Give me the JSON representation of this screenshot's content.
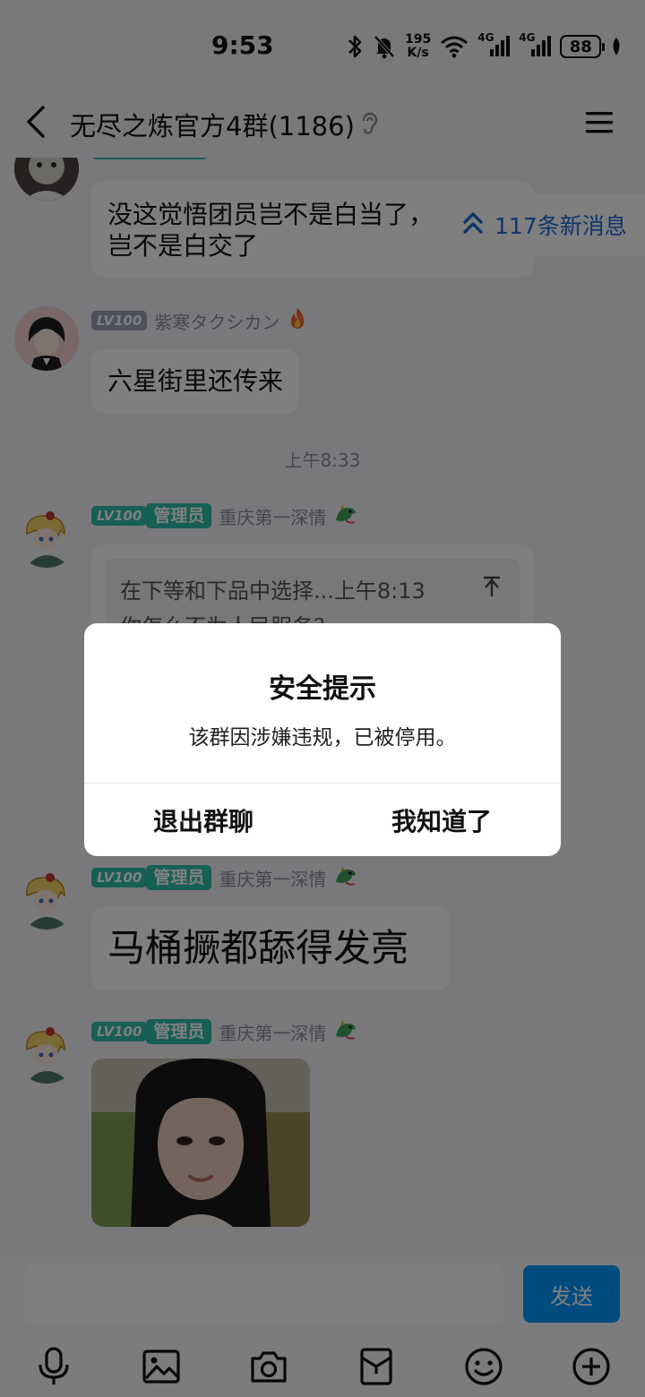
{
  "status_bar": {
    "time": "9:53",
    "net_speed_value": "195",
    "net_speed_unit": "K/s",
    "network_1": "4G",
    "network_2": "4G",
    "battery": "88"
  },
  "nav": {
    "title": "无尽之炼官方4群(1186)"
  },
  "new_messages": {
    "label": "117条新消息"
  },
  "messages": [
    {
      "text_line1": "没这觉悟团员岂不是白当了，",
      "text_line2": "岂不是白交了"
    },
    {
      "level": "LV100",
      "sender": "紫寒タクシカン",
      "text": "六星街里还传来"
    },
    {
      "time": "上午8:33"
    },
    {
      "level": "LV100",
      "role": "管理员",
      "sender": "重庆第一深情",
      "quote": "在下等和下品中选择...上午8:13",
      "quote_line2": "你怎么不为人民服务？"
    },
    {
      "level": "LV100",
      "role": "管理员",
      "sender": "重庆第一深情",
      "text": "马桶撅都舔得发亮"
    },
    {
      "level": "LV100",
      "role": "管理员",
      "sender": "重庆第一深情",
      "image": "photo"
    }
  ],
  "input": {
    "placeholder": "",
    "send_label": "发送"
  },
  "toolbar": {
    "icons": [
      "microphone-icon",
      "image-icon",
      "camera-icon",
      "red-packet-icon",
      "emoji-icon",
      "plus-icon"
    ]
  },
  "dialog": {
    "title": "安全提示",
    "message": "该群因涉嫌违规，已被停用。",
    "left_button": "退出群聊",
    "right_button": "我知道了"
  },
  "colors": {
    "accent": "#0099ff",
    "link": "#1e6bd6",
    "admin_badge": "#2fbfa9",
    "level_badge": "#9aa2b5",
    "background": "#f2f3f7"
  }
}
